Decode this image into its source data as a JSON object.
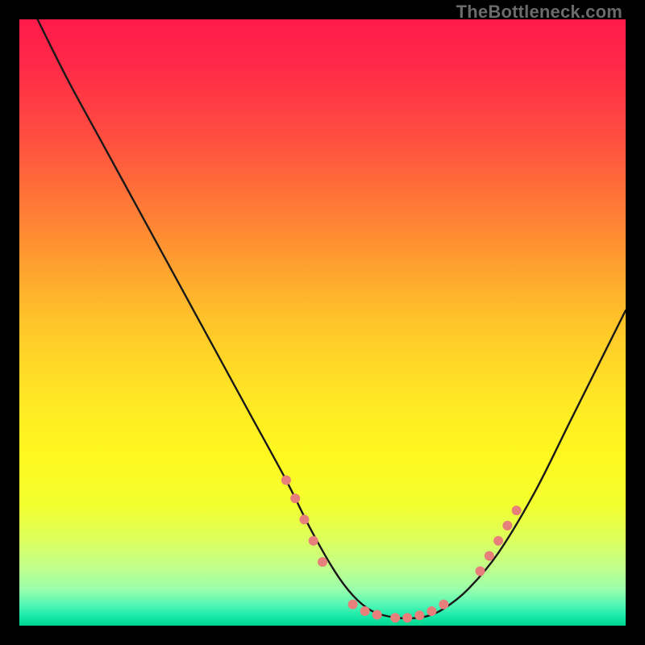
{
  "watermark": "TheBottleneck.com",
  "chart_data": {
    "type": "line",
    "title": "",
    "xlabel": "",
    "ylabel": "",
    "xlim": [
      0,
      100
    ],
    "ylim": [
      0,
      100
    ],
    "grid": false,
    "legend": false,
    "gradient_stops": [
      {
        "offset": 0.0,
        "color": "#ff1a4b"
      },
      {
        "offset": 0.08,
        "color": "#ff2a47"
      },
      {
        "offset": 0.2,
        "color": "#ff5040"
      },
      {
        "offset": 0.35,
        "color": "#ff8a33"
      },
      {
        "offset": 0.5,
        "color": "#ffc529"
      },
      {
        "offset": 0.62,
        "color": "#ffe625"
      },
      {
        "offset": 0.72,
        "color": "#fff81f"
      },
      {
        "offset": 0.8,
        "color": "#f3ff2f"
      },
      {
        "offset": 0.86,
        "color": "#dcff5e"
      },
      {
        "offset": 0.905,
        "color": "#c0ff8c"
      },
      {
        "offset": 0.94,
        "color": "#9affab"
      },
      {
        "offset": 0.965,
        "color": "#55f7b6"
      },
      {
        "offset": 0.985,
        "color": "#17e8a8"
      },
      {
        "offset": 1.0,
        "color": "#00d68f"
      }
    ],
    "series": [
      {
        "name": "bottleneck-curve",
        "color": "#191919",
        "x": [
          3,
          8,
          14,
          20,
          26,
          32,
          38,
          44,
          48,
          52,
          55,
          58,
          61,
          64,
          67,
          70,
          74,
          79,
          85,
          91,
          97,
          100
        ],
        "y": [
          100,
          90,
          79,
          68,
          57,
          46,
          35,
          24,
          16,
          9,
          5,
          2.5,
          1.5,
          1.2,
          1.5,
          2.8,
          6,
          12,
          22,
          34,
          46,
          52
        ]
      }
    ],
    "markers": {
      "name": "highlighted-points",
      "color": "#e77f7b",
      "radius_px": 6,
      "points": [
        {
          "x": 44,
          "y": 24
        },
        {
          "x": 45.5,
          "y": 21
        },
        {
          "x": 47,
          "y": 17.5
        },
        {
          "x": 48.5,
          "y": 14
        },
        {
          "x": 50,
          "y": 10.5
        },
        {
          "x": 55,
          "y": 3.5
        },
        {
          "x": 57,
          "y": 2.4
        },
        {
          "x": 59,
          "y": 1.8
        },
        {
          "x": 62,
          "y": 1.3
        },
        {
          "x": 64,
          "y": 1.3
        },
        {
          "x": 66,
          "y": 1.7
        },
        {
          "x": 68,
          "y": 2.4
        },
        {
          "x": 70,
          "y": 3.5
        },
        {
          "x": 76,
          "y": 9
        },
        {
          "x": 77.5,
          "y": 11.5
        },
        {
          "x": 79,
          "y": 14
        },
        {
          "x": 80.5,
          "y": 16.5
        },
        {
          "x": 82,
          "y": 19
        }
      ]
    }
  }
}
